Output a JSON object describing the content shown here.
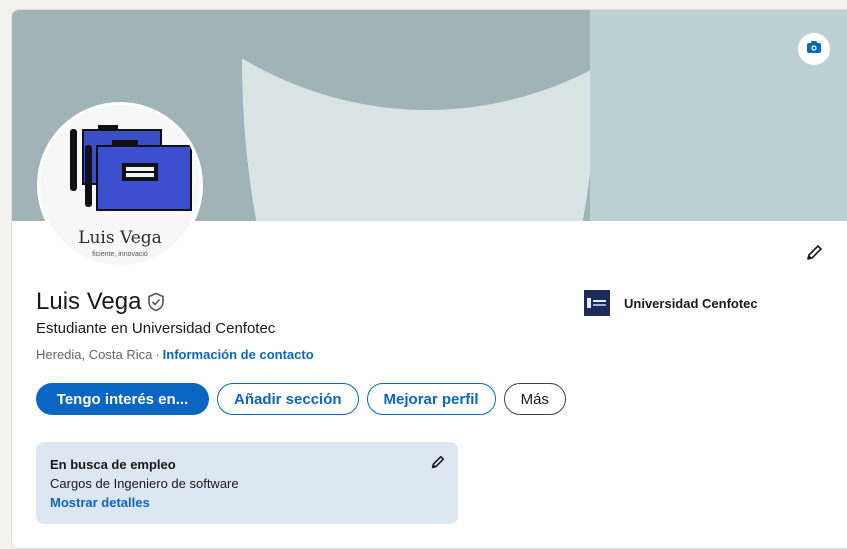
{
  "profile": {
    "name": "Luis Vega",
    "headline": "Estudiante en Universidad Cenfotec",
    "location": "Heredia, Costa Rica",
    "separator": "·",
    "contact_link": "Información de contacto",
    "avatar_name": "Luis Vega",
    "avatar_tagline": "ficiente, innovació"
  },
  "organization": {
    "name": "Universidad Cenfotec",
    "logo_icon": "university-logo-icon"
  },
  "actions": {
    "primary": "Tengo interés en...",
    "add_section": "Añadir sección",
    "improve_profile": "Mejorar perfil",
    "more": "Más"
  },
  "open_to_work": {
    "title": "En busca de empleo",
    "subtitle": "Cargos de Ingeniero de software",
    "link": "Mostrar detalles"
  },
  "icons": {
    "camera": "camera-icon",
    "edit": "pencil-icon",
    "verified": "verified-shield-icon"
  },
  "colors": {
    "accent": "#0a66c2",
    "banner": "#a0b4b7",
    "banner_light": "#bcd1d4",
    "otw_background": "#dde7f1"
  }
}
